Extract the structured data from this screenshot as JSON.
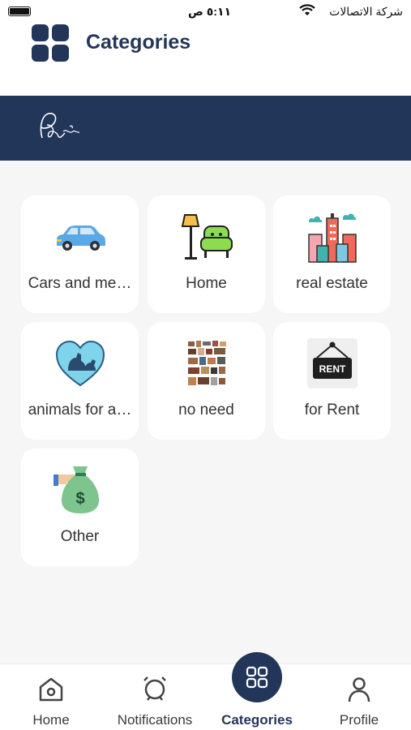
{
  "status_bar": {
    "time": "٥:١١ ص",
    "carrier": "شركة الاتصالات"
  },
  "header": {
    "title": "Categories",
    "logo_icon": "category-grid-icon"
  },
  "banner": {
    "logo_icon": "signature-logo-icon"
  },
  "categories": [
    {
      "label": "Cars and me…",
      "icon": "car-icon"
    },
    {
      "label": "Home",
      "icon": "lamp-sofa-icon"
    },
    {
      "label": "real estate",
      "icon": "buildings-icon"
    },
    {
      "label": "animals for a…",
      "icon": "pet-heart-icon"
    },
    {
      "label": "no need",
      "icon": "furniture-collage-icon"
    },
    {
      "label": "for Rent",
      "icon": "rent-sign-icon"
    },
    {
      "label": "Other",
      "icon": "money-bag-icon"
    }
  ],
  "tabbar": {
    "tabs": [
      {
        "label": "Home",
        "icon": "home-icon"
      },
      {
        "label": "Notifications",
        "icon": "notifications-icon"
      },
      {
        "label": "Categories",
        "icon": "categories-icon",
        "active": true
      },
      {
        "label": "Profile",
        "icon": "profile-icon"
      }
    ]
  },
  "colors": {
    "navy": "#22365a",
    "background": "#f6f6f6",
    "card": "#ffffff"
  }
}
